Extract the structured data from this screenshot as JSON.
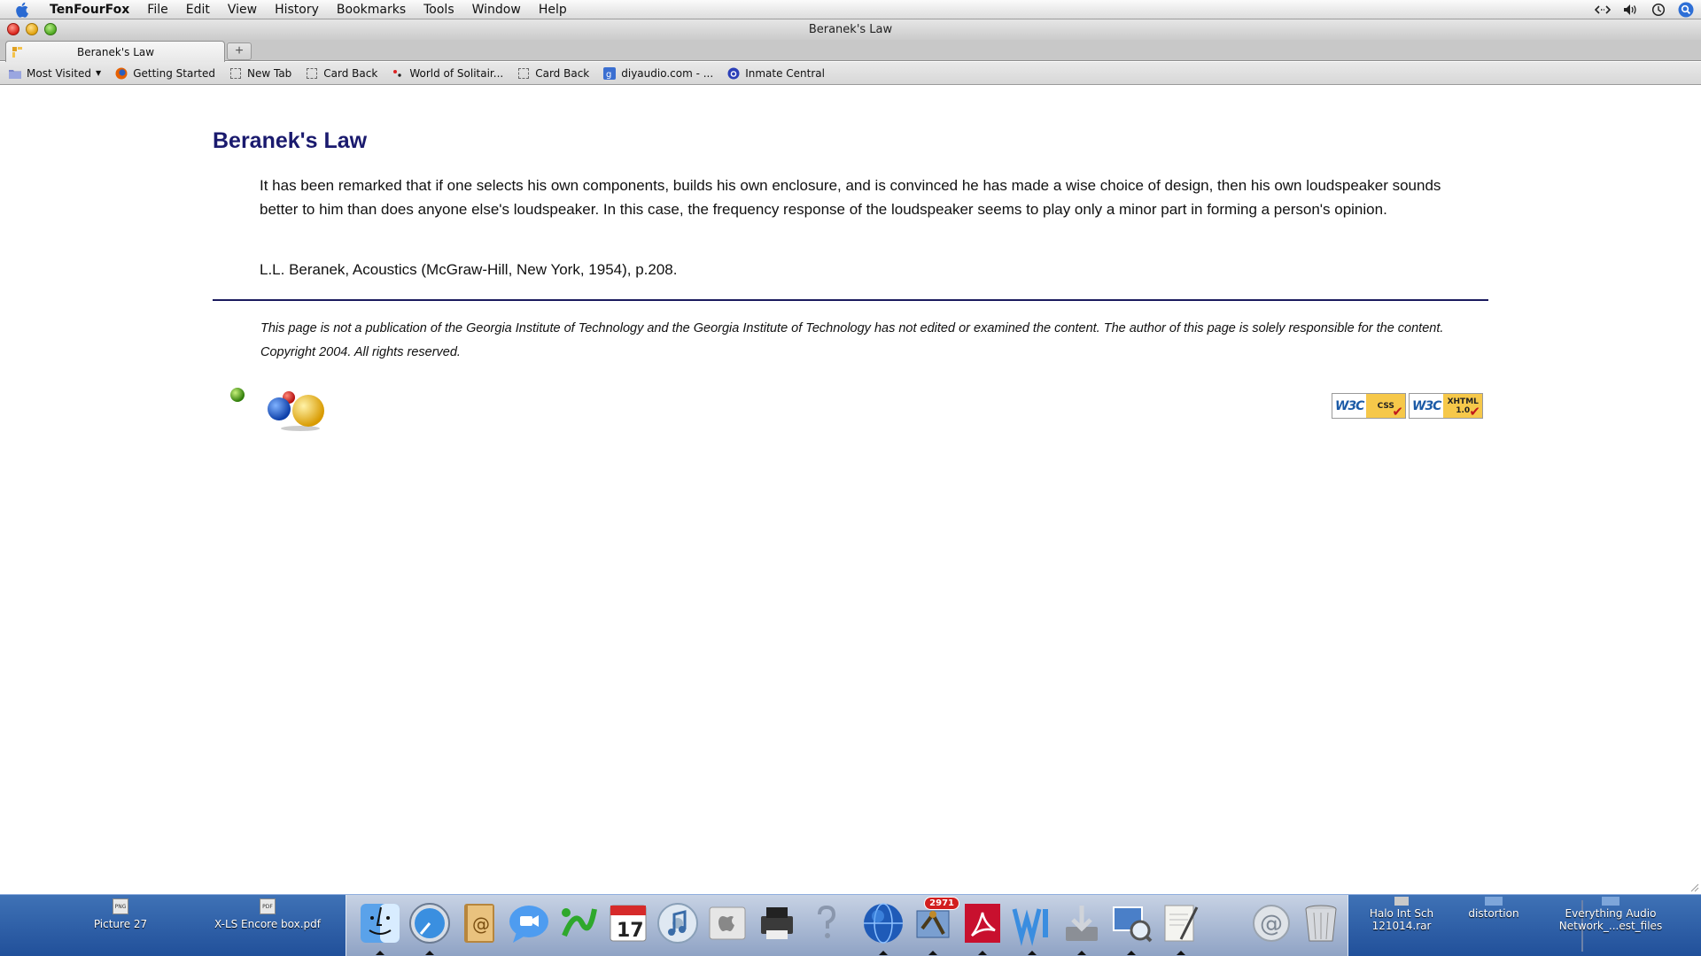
{
  "menubar": {
    "app_name": "TenFourFox",
    "items": [
      "File",
      "Edit",
      "View",
      "History",
      "Bookmarks",
      "Tools",
      "Window",
      "Help"
    ]
  },
  "window": {
    "title": "Beranek's Law"
  },
  "tabs": [
    {
      "label": "Beranek's Law"
    }
  ],
  "new_tab_label": "+",
  "bookmarks": [
    {
      "label": "Most Visited",
      "icon": "folder-icon"
    },
    {
      "label": "Getting Started",
      "icon": "firefox-icon"
    },
    {
      "label": "New Tab",
      "icon": "page-icon"
    },
    {
      "label": "Card Back",
      "icon": "page-icon"
    },
    {
      "label": "World of Solitair...",
      "icon": "cards-icon"
    },
    {
      "label": "Card Back",
      "icon": "page-icon"
    },
    {
      "label": "diyaudio.com - ...",
      "icon": "diyaudio-icon"
    },
    {
      "label": "Inmate Central",
      "icon": "inmate-icon"
    }
  ],
  "page": {
    "heading": "Beranek's Law",
    "quote": "It has been remarked that if one selects his own components, builds his own enclosure, and is convinced he has made a wise choice of design, then his own loudspeaker sounds better to him than does anyone else's loudspeaker. In this case, the frequency response of the loudspeaker seems to play only a minor part in forming a person's opinion.",
    "citation": "L.L. Beranek, Acoustics (McGraw-Hill, New York, 1954), p.208.",
    "disclaimer": "This page is not a publication of the Georgia Institute of Technology and the Georgia Institute of Technology has not edited or examined the content. The author of this page is solely responsible for the content.",
    "copyright": "Copyright 2004. All rights reserved.",
    "badges": {
      "css": {
        "w3c": "W3C",
        "kind": "CSS"
      },
      "xhtml": {
        "w3c": "W3C",
        "kind": "XHTML",
        "version": "1.0"
      }
    }
  },
  "desktop_left": [
    {
      "label": "Picture 27",
      "thumb": "PNG"
    },
    {
      "label": "X-LS Encore box.pdf",
      "thumb": "PDF"
    }
  ],
  "dock": {
    "apps": [
      "finder-icon",
      "safari-icon",
      "address-book-icon",
      "ichat-icon",
      "app-icon",
      "ical-icon",
      "itunes-icon",
      "system-profiler-icon",
      "printer-icon",
      "help-icon",
      "network-globe-icon",
      "mail-icon",
      "acrobat-icon",
      "word-icon",
      "downloader-icon",
      "preview-icon",
      "textedit-icon"
    ],
    "ical_date": "17",
    "mail_badge": "2971",
    "right_items": [
      "mail-stack-icon",
      "trash-icon"
    ]
  },
  "desktop_right": [
    {
      "label_line1": "Halo Int Sch",
      "label_line2": "121014.rar"
    },
    {
      "label_line1": "distortion",
      "label_line2": ""
    },
    {
      "label_line1": "Everything Audio",
      "label_line2": "Network_...est_files"
    }
  ],
  "colors": {
    "heading": "#1a1a6e",
    "rule": "#1a1a5e",
    "dock": "#2c5ea6"
  }
}
